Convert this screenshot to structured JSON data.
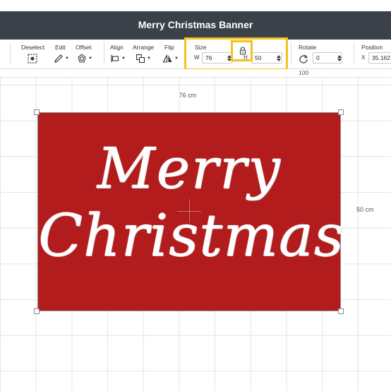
{
  "window": {
    "title": "Merry Christmas Banner"
  },
  "toolbar": {
    "deselect_label": "Deselect",
    "edit_label": "Edit",
    "offset_label": "Offset",
    "align_label": "Align",
    "arrange_label": "Arrange",
    "flip_label": "Flip",
    "size": {
      "label": "Size",
      "w_label": "W",
      "w_value": "76",
      "h_label": "H",
      "h_value": "50"
    },
    "rotate": {
      "label": "Rotate",
      "value": "0"
    },
    "position": {
      "label": "Position",
      "x_label": "X",
      "x_value": "35.162"
    }
  },
  "ruler": {
    "mark": "100"
  },
  "canvas": {
    "width_dimension": "76 cm",
    "height_dimension": "50 cm",
    "banner": {
      "line1": "Merry",
      "line2": "Christmas",
      "fill_color": "#b31c1c",
      "text_color": "#ffffff"
    }
  },
  "highlight_color": "#f4c21b"
}
